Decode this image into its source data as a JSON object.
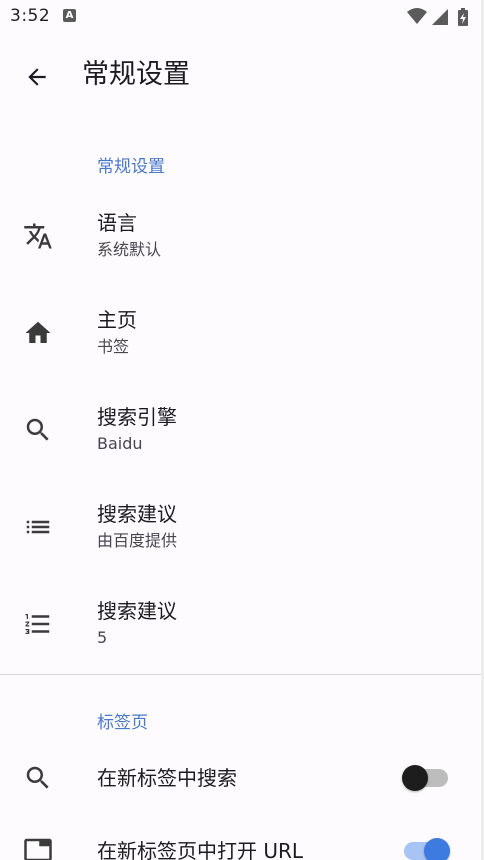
{
  "status_bar": {
    "time": "3:52",
    "notification_icon": "a-box-icon",
    "icons": [
      "wifi-icon",
      "signal-icon",
      "battery-charging-icon"
    ]
  },
  "app_bar": {
    "back_icon": "arrow-back-icon",
    "title": "常规设置"
  },
  "sections": [
    {
      "header": "常规设置",
      "items": [
        {
          "icon": "translate-icon",
          "title": "语言",
          "summary": "系统默认"
        },
        {
          "icon": "home-icon",
          "title": "主页",
          "summary": "书签"
        },
        {
          "icon": "search-icon",
          "title": "搜索引擎",
          "summary": "Baidu"
        },
        {
          "icon": "list-icon",
          "title": "搜索建议",
          "summary": "由百度提供"
        },
        {
          "icon": "numbered-list-icon",
          "title": "搜索建议",
          "summary": "5"
        }
      ]
    },
    {
      "header": "标签页",
      "items": [
        {
          "icon": "search-icon",
          "title": "在新标签中搜索",
          "switch": "off"
        },
        {
          "icon": "tab-icon",
          "title": "在新标签页中打开 URL",
          "switch": "on"
        }
      ]
    }
  ],
  "colors": {
    "background": "#fdfbfe",
    "accent": "#4a78c9",
    "switch_on": "#3e7be0"
  }
}
